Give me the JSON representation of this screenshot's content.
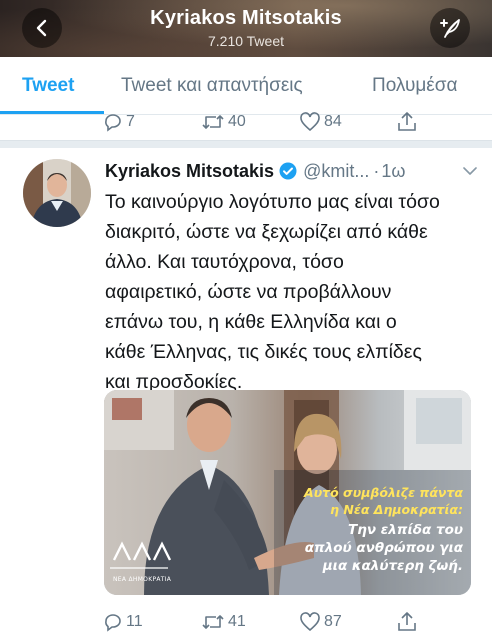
{
  "header": {
    "title": "Kyriakos Mitsotakis",
    "tweet_count": "7.210 Tweet"
  },
  "tabs": [
    {
      "label": "Tweet",
      "active": true
    },
    {
      "label": "Tweet και απαντήσεις",
      "active": false
    },
    {
      "label": "Πολυμέσα",
      "active": false
    }
  ],
  "previous_tweet": {
    "replies": "7",
    "retweets": "40",
    "likes": "84"
  },
  "tweet": {
    "author_name": "Kyriakos Mitsotakis",
    "handle": "@kmit...",
    "separator": "·",
    "time": "1ω",
    "text_lines": [
      "Το καινούργιο λογότυπο μας είναι τόσο",
      "διακριτό, ώστε να ξεχωρίζει από κάθε",
      "άλλο. Και ταυτόχρονα, τόσο",
      "αφαιρετικό, ώστε να προβάλλουν",
      "επάνω του, η κάθε Ελληνίδα και ο",
      "κάθε Έλληνας, τις δικές τους ελπίδες",
      "και προσδοκίες."
    ],
    "media": {
      "caption_yellow": [
        "Αυτό συμβόλιζε πάντα",
        "η Νέα Δημοκρατία:"
      ],
      "caption_white": [
        "Την ελπίδα του",
        "απλού ανθρώπου για",
        "μια καλύτερη ζωή."
      ],
      "logo_text": "ΝΕΑ ΔΗΜΟΚΡΑΤΙΑ"
    },
    "replies": "11",
    "retweets": "41",
    "likes": "87"
  },
  "colors": {
    "accent": "#1da1f2",
    "muted": "#657786",
    "text": "#14171a"
  }
}
